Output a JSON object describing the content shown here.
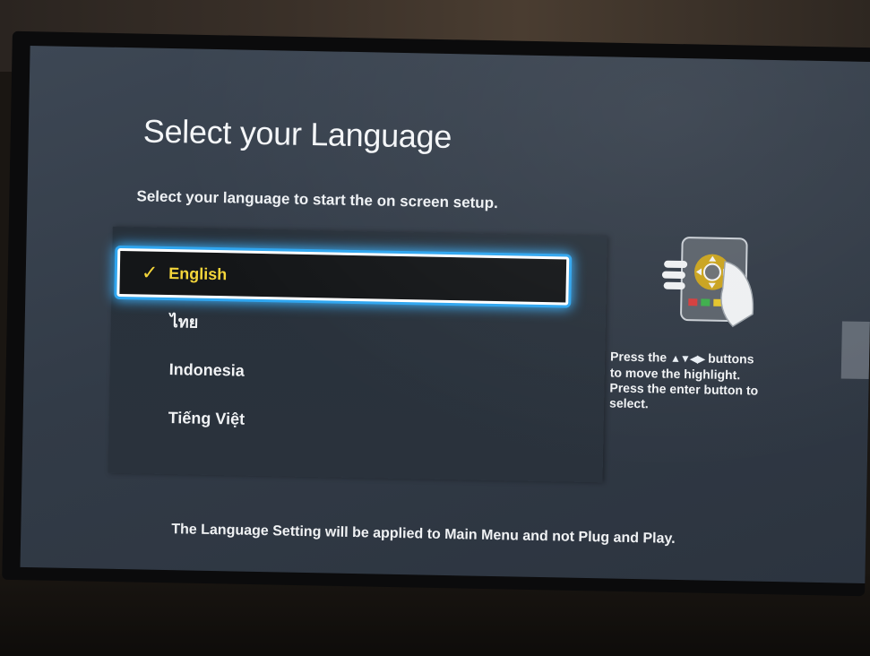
{
  "screen": {
    "title": "Select your Language",
    "subtitle": "Select your language to start the on screen setup."
  },
  "languages": [
    {
      "label": "English",
      "selected": true
    },
    {
      "label": "ไทย",
      "selected": false
    },
    {
      "label": "Indonesia",
      "selected": false
    },
    {
      "label": "Tiếng Việt",
      "selected": false
    }
  ],
  "help": {
    "press_the": "Press the",
    "arrow_glyphs": "▲▼◀▶",
    "buttons": "buttons",
    "line2": "to move the highlight.",
    "line3": "Press the enter button to",
    "line4": "select."
  },
  "footer": {
    "note": "The Language Setting will be applied to Main Menu and not Plug and Play."
  },
  "icons": {
    "checkmark": "checkmark-icon",
    "remote": "remote-control-icon"
  },
  "colors": {
    "selection_text": "#f5d63a",
    "selection_glow": "#3db3ff",
    "screen_bg": "#323b47"
  }
}
